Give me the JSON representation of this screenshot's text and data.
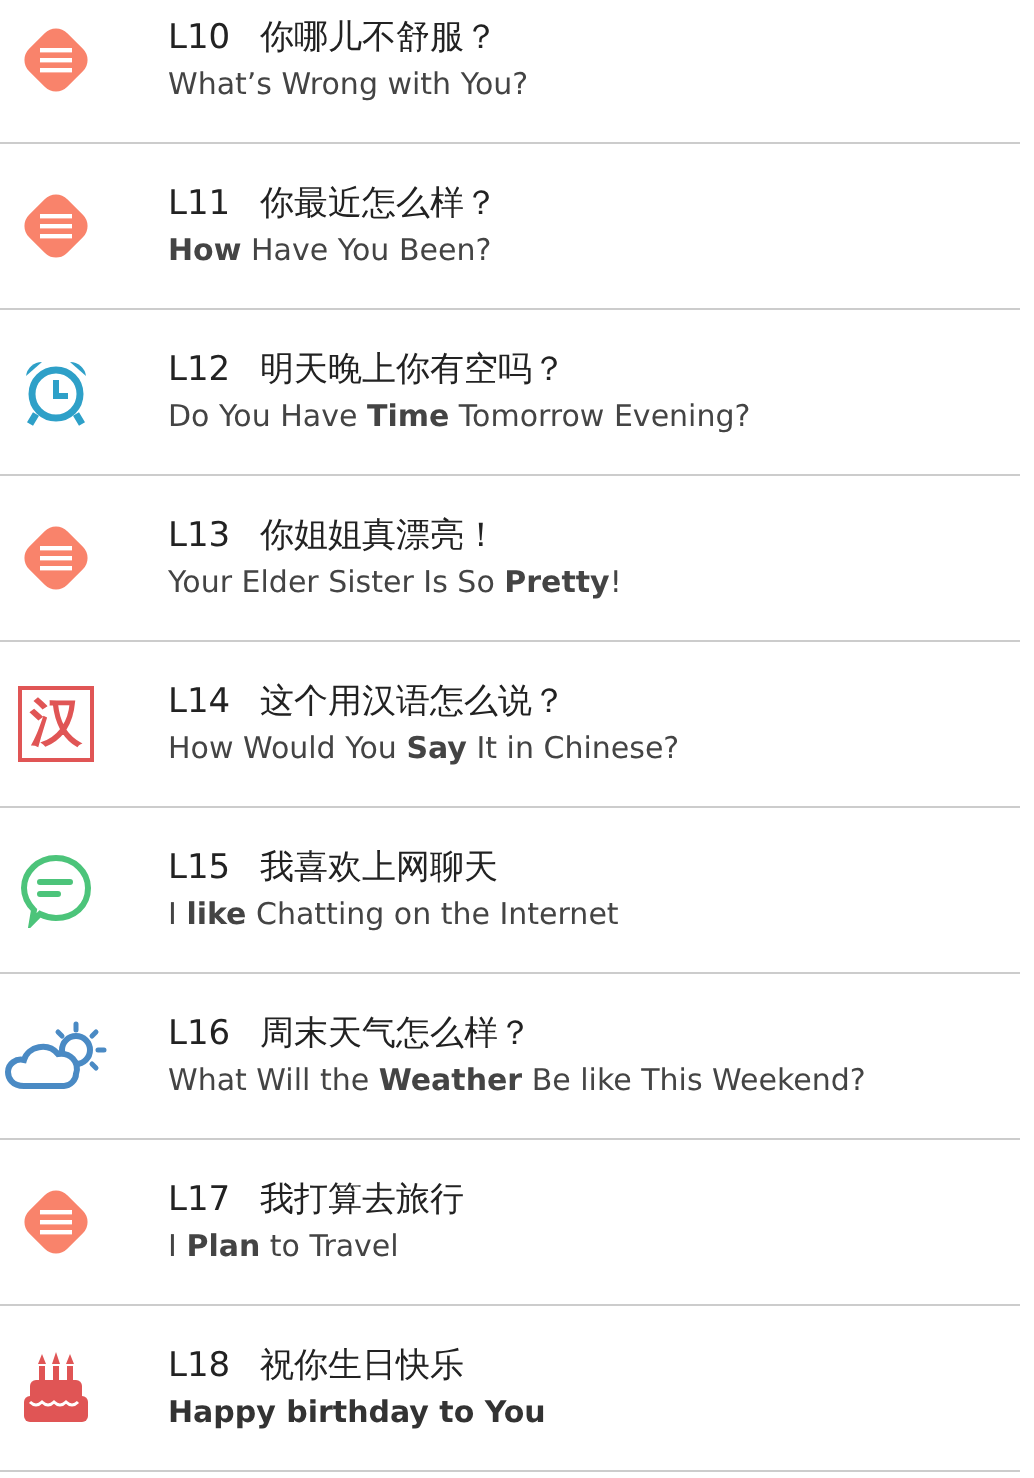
{
  "lessons": [
    {
      "number": "L10",
      "title": "你哪儿不舒服？",
      "subtitle": "What’s Wrong with You?",
      "subtitle_bold": false,
      "kind": "menu"
    },
    {
      "number": "L11",
      "title": "你最近怎么样？",
      "subtitle": "**How** Have You Been?",
      "subtitle_bold": false,
      "kind": "menu"
    },
    {
      "number": "L12",
      "title": "明天晚上你有空吗？",
      "subtitle": "Do You Have **Time** Tomorrow Evening?",
      "subtitle_bold": false,
      "kind": "alarm"
    },
    {
      "number": "L13",
      "title": "你姐姐真漂亮！",
      "subtitle": "Your Elder Sister Is So **Pretty**!",
      "subtitle_bold": false,
      "kind": "menu"
    },
    {
      "number": "L14",
      "title": "这个用汉语怎么说？",
      "subtitle": "How Would You **Say** It in Chinese?",
      "subtitle_bold": false,
      "kind": "character",
      "icon_text": "汉"
    },
    {
      "number": "L15",
      "title": "我喜欢上网聊天",
      "subtitle": "I **like** Chatting on the Internet",
      "subtitle_bold": false,
      "kind": "chat"
    },
    {
      "number": "L16",
      "title": "周末天气怎么样？",
      "subtitle": "What Will the **Weather** Be like This Weekend?",
      "subtitle_bold": false,
      "kind": "weather"
    },
    {
      "number": "L17",
      "title": "我打算去旅行",
      "subtitle": "I **Plan** to Travel",
      "subtitle_bold": false,
      "kind": "menu"
    },
    {
      "number": "L18",
      "title": "祝你生日快乐",
      "subtitle": "Happy birthday to You",
      "subtitle_bold": true,
      "kind": "cake"
    }
  ]
}
